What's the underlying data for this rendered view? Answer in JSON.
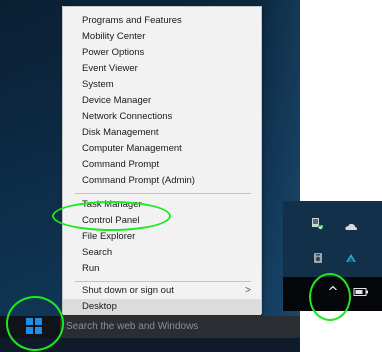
{
  "winx_menu": {
    "items": [
      {
        "label": "Programs and Features"
      },
      {
        "label": "Mobility Center"
      },
      {
        "label": "Power Options"
      },
      {
        "label": "Event Viewer"
      },
      {
        "label": "System"
      },
      {
        "label": "Device Manager"
      },
      {
        "label": "Network Connections"
      },
      {
        "label": "Disk Management"
      },
      {
        "label": "Computer Management"
      },
      {
        "label": "Command Prompt"
      },
      {
        "label": "Command Prompt (Admin)"
      },
      {
        "label": "Task Manager"
      },
      {
        "label": "Control Panel"
      },
      {
        "label": "File Explorer"
      },
      {
        "label": "Search"
      },
      {
        "label": "Run"
      },
      {
        "label": "Shut down or sign out"
      },
      {
        "label": "Desktop"
      }
    ],
    "submenu_arrow": ">"
  },
  "taskbar": {
    "search_placeholder": "Search the web and Windows"
  },
  "tray": {
    "show_hidden_icons_glyph": "^"
  },
  "colors": {
    "highlight": "#1ee81e",
    "start_logo": "#1e8fe8",
    "menu_background": "#f2f2f2"
  }
}
